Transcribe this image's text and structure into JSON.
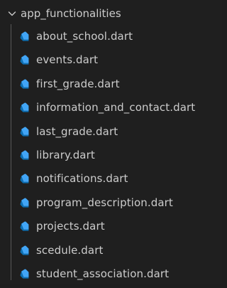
{
  "explorer": {
    "folder": {
      "name": "app_functionalities",
      "icon": "chevron-down-icon"
    },
    "file_icon": "dart-file-icon",
    "colors": {
      "background": "#1f1f1f",
      "text": "#cccccc",
      "dart_icon_light": "#42a5f5",
      "dart_icon_dark": "#0c6fb3"
    },
    "files": [
      {
        "name": "about_school.dart"
      },
      {
        "name": "events.dart"
      },
      {
        "name": "first_grade.dart"
      },
      {
        "name": "information_and_contact.dart"
      },
      {
        "name": "last_grade.dart"
      },
      {
        "name": "library.dart"
      },
      {
        "name": "notifications.dart"
      },
      {
        "name": "program_description.dart"
      },
      {
        "name": "projects.dart"
      },
      {
        "name": "scedule.dart"
      },
      {
        "name": "student_association.dart"
      }
    ]
  }
}
